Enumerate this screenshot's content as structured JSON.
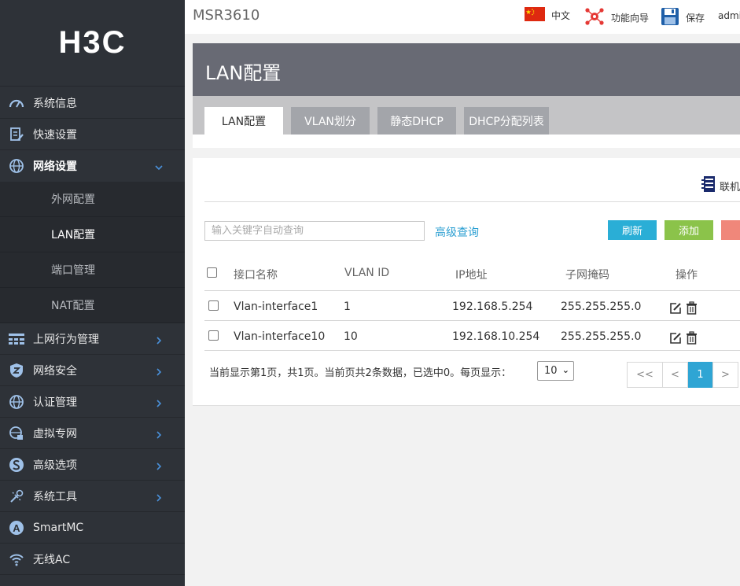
{
  "brand": {
    "logo_text": "H3C"
  },
  "sidebar": {
    "items": [
      {
        "label": "系统信息"
      },
      {
        "label": "快速设置"
      },
      {
        "label": "网络设置"
      },
      {
        "label": "上网行为管理"
      },
      {
        "label": "网络安全"
      },
      {
        "label": "认证管理"
      },
      {
        "label": "虚拟专网"
      },
      {
        "label": "高级选项"
      },
      {
        "label": "系统工具"
      },
      {
        "label": "SmartMC"
      },
      {
        "label": "无线AC"
      }
    ],
    "subitems": [
      {
        "label": "外网配置"
      },
      {
        "label": "LAN配置"
      },
      {
        "label": "端口管理"
      },
      {
        "label": "NAT配置"
      }
    ]
  },
  "header": {
    "model": "MSR3610",
    "language": "中文",
    "wizard": "功能向导",
    "save": "保存",
    "user": "admi"
  },
  "page": {
    "title": "LAN配置",
    "tabs": [
      {
        "label": "LAN配置"
      },
      {
        "label": "VLAN划分"
      },
      {
        "label": "静态DHCP"
      },
      {
        "label": "DHCP分配列表"
      }
    ]
  },
  "toolbar": {
    "online_label": "联机",
    "search_placeholder": "输入关键字自动查询",
    "advanced_query": "高级查询",
    "refresh": "刷新",
    "add": "添加"
  },
  "table": {
    "headers": [
      "接口名称",
      "VLAN ID",
      "IP地址",
      "子网掩码",
      "操作"
    ],
    "rows": [
      {
        "name": "Vlan-interface1",
        "vlan": "1",
        "ip": "192.168.5.254",
        "mask": "255.255.255.0"
      },
      {
        "name": "Vlan-interface10",
        "vlan": "10",
        "ip": "192.168.10.254",
        "mask": "255.255.255.0"
      }
    ]
  },
  "pagination": {
    "summary": "当前显示第1页，共1页。当前页共2条数据，已选中0。每页显示：",
    "page_size": "10",
    "first": "<<",
    "prev": "<",
    "current": "1",
    "next": ">"
  },
  "colors": {
    "sidebar_bg": "#2e3238",
    "accent_blue": "#2fa5d4",
    "refresh_btn": "#2aaed6",
    "add_btn": "#8bc34a",
    "delete_btn": "#f0877a",
    "panel_header": "#686a74"
  }
}
